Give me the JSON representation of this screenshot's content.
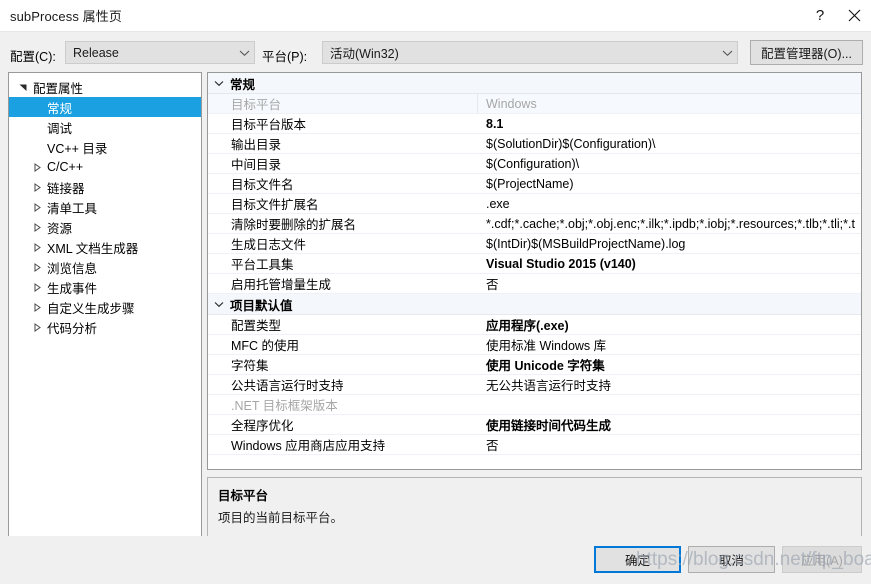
{
  "window": {
    "title": "subProcess 属性页",
    "help_icon": "question-mark-icon",
    "close_icon": "close-icon"
  },
  "configbar": {
    "config_label": "配置(C):",
    "config_value": "Release",
    "platform_label": "平台(P):",
    "platform_value": "活动(Win32)",
    "config_manager_button": "配置管理器(O)..."
  },
  "tree": {
    "items": [
      {
        "label": "配置属性",
        "level": 0,
        "twisty": "expanded",
        "selected": false
      },
      {
        "label": "常规",
        "level": 1,
        "twisty": "none",
        "selected": true
      },
      {
        "label": "调试",
        "level": 1,
        "twisty": "none",
        "selected": false
      },
      {
        "label": "VC++ 目录",
        "level": 1,
        "twisty": "none",
        "selected": false
      },
      {
        "label": "C/C++",
        "level": 1,
        "twisty": "collapsed",
        "selected": false
      },
      {
        "label": "链接器",
        "level": 1,
        "twisty": "collapsed",
        "selected": false
      },
      {
        "label": "清单工具",
        "level": 1,
        "twisty": "collapsed",
        "selected": false
      },
      {
        "label": "资源",
        "level": 1,
        "twisty": "collapsed",
        "selected": false
      },
      {
        "label": "XML 文档生成器",
        "level": 1,
        "twisty": "collapsed",
        "selected": false
      },
      {
        "label": "浏览信息",
        "level": 1,
        "twisty": "collapsed",
        "selected": false
      },
      {
        "label": "生成事件",
        "level": 1,
        "twisty": "collapsed",
        "selected": false
      },
      {
        "label": "自定义生成步骤",
        "level": 1,
        "twisty": "collapsed",
        "selected": false
      },
      {
        "label": "代码分析",
        "level": 1,
        "twisty": "collapsed",
        "selected": false
      }
    ]
  },
  "grid": {
    "groups": [
      {
        "title": "常规",
        "expanded": true,
        "rows": [
          {
            "name": "目标平台",
            "value": "Windows",
            "bold": false,
            "disabled": true,
            "selected": true
          },
          {
            "name": "目标平台版本",
            "value": "8.1",
            "bold": true,
            "disabled": false,
            "selected": false
          },
          {
            "name": "输出目录",
            "value": "$(SolutionDir)$(Configuration)\\",
            "bold": false,
            "disabled": false,
            "selected": false
          },
          {
            "name": "中间目录",
            "value": "$(Configuration)\\",
            "bold": false,
            "disabled": false,
            "selected": false
          },
          {
            "name": "目标文件名",
            "value": "$(ProjectName)",
            "bold": false,
            "disabled": false,
            "selected": false
          },
          {
            "name": "目标文件扩展名",
            "value": ".exe",
            "bold": false,
            "disabled": false,
            "selected": false
          },
          {
            "name": "清除时要删除的扩展名",
            "value": "*.cdf;*.cache;*.obj;*.obj.enc;*.ilk;*.ipdb;*.iobj;*.resources;*.tlb;*.tli;*.t",
            "bold": false,
            "disabled": false,
            "selected": false
          },
          {
            "name": "生成日志文件",
            "value": "$(IntDir)$(MSBuildProjectName).log",
            "bold": false,
            "disabled": false,
            "selected": false
          },
          {
            "name": "平台工具集",
            "value": "Visual Studio 2015 (v140)",
            "bold": true,
            "disabled": false,
            "selected": false
          },
          {
            "name": "启用托管增量生成",
            "value": "否",
            "bold": false,
            "disabled": false,
            "selected": false
          }
        ]
      },
      {
        "title": "项目默认值",
        "expanded": true,
        "rows": [
          {
            "name": "配置类型",
            "value": "应用程序(.exe)",
            "bold": true,
            "disabled": false,
            "selected": false
          },
          {
            "name": "MFC 的使用",
            "value": "使用标准 Windows 库",
            "bold": false,
            "disabled": false,
            "selected": false
          },
          {
            "name": "字符集",
            "value": "使用 Unicode 字符集",
            "bold": true,
            "disabled": false,
            "selected": false
          },
          {
            "name": "公共语言运行时支持",
            "value": "无公共语言运行时支持",
            "bold": false,
            "disabled": false,
            "selected": false
          },
          {
            "name": ".NET 目标框架版本",
            "value": "",
            "bold": false,
            "disabled": true,
            "selected": false
          },
          {
            "name": "全程序优化",
            "value": "使用链接时间代码生成",
            "bold": true,
            "disabled": false,
            "selected": false
          },
          {
            "name": "Windows 应用商店应用支持",
            "value": "否",
            "bold": false,
            "disabled": false,
            "selected": false
          }
        ]
      }
    ],
    "empty_rows": 2
  },
  "description": {
    "title": "目标平台",
    "text": "项目的当前目标平台。"
  },
  "footer": {
    "ok": "确定",
    "cancel": "取消",
    "apply": "应用(A)"
  },
  "watermark": {
    "text": "https://blog.csdn.net/ftp_board"
  },
  "colors": {
    "selection_blue": "#1ba1e2",
    "focus_border": "#0078d7",
    "dialog_bg": "#f0f0f0",
    "grid_bg": "#ffffff",
    "category_bg": "#f4f7fb",
    "disabled_text": "#a6a6a6"
  }
}
